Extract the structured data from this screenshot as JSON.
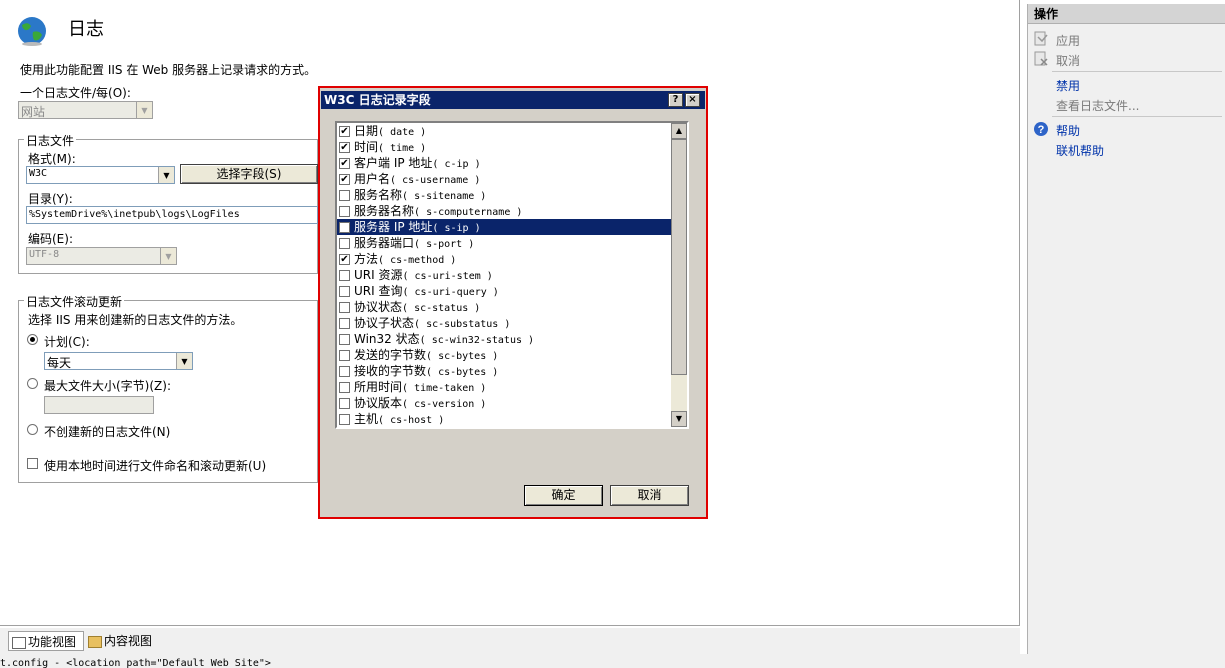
{
  "page": {
    "title": "日志",
    "description": "使用此功能配置 IIS 在 Web 服务器上记录请求的方式。",
    "one_log_label": "一个日志文件/每(O):",
    "one_log_value": "网站",
    "logfile_group": "日志文件",
    "format_label": "格式(M):",
    "format_value": "W3C",
    "select_fields_button": "选择字段(S)",
    "directory_label": "目录(Y):",
    "directory_value": "%SystemDrive%\\inetpub\\logs\\LogFiles",
    "encoding_label": "编码(E):",
    "encoding_value": "UTF-8",
    "rollover_group": "日志文件滚动更新",
    "rollover_desc": "选择 IIS 用来创建新的日志文件的方法。",
    "schedule_label": "计划(C):",
    "schedule_value": "每天",
    "maxsize_label": "最大文件大小(字节)(Z):",
    "no_new_label": "不创建新的日志文件(N)",
    "local_time_label": "使用本地时间进行文件命名和滚动更新(U)"
  },
  "actions": {
    "header": "操作",
    "apply": "应用",
    "cancel": "取消",
    "disable": "禁用",
    "view_logs": "查看日志文件...",
    "help": "帮助",
    "online_help": "联机帮助"
  },
  "dialog": {
    "title": "W3C 日志记录字段",
    "help_btn": "?",
    "close_btn": "×",
    "ok": "确定",
    "cancel": "取消",
    "fields": [
      {
        "name": "日期",
        "code": "date",
        "checked": true
      },
      {
        "name": "时间",
        "code": "time",
        "checked": true
      },
      {
        "name": "客户端 IP 地址",
        "code": "c-ip",
        "checked": true
      },
      {
        "name": "用户名",
        "code": "cs-username",
        "checked": true
      },
      {
        "name": "服务名称",
        "code": "s-sitename",
        "checked": false
      },
      {
        "name": "服务器名称",
        "code": "s-computername",
        "checked": false
      },
      {
        "name": "服务器 IP 地址",
        "code": "s-ip",
        "checked": false,
        "selected": true
      },
      {
        "name": "服务器端口",
        "code": "s-port",
        "checked": false
      },
      {
        "name": "方法",
        "code": "cs-method",
        "checked": true
      },
      {
        "name": "URI 资源",
        "code": "cs-uri-stem",
        "checked": false
      },
      {
        "name": "URI 查询",
        "code": "cs-uri-query",
        "checked": false
      },
      {
        "name": "协议状态",
        "code": "sc-status",
        "checked": false
      },
      {
        "name": "协议子状态",
        "code": "sc-substatus",
        "checked": false
      },
      {
        "name": "Win32 状态",
        "code": "sc-win32-status",
        "checked": false
      },
      {
        "name": "发送的字节数",
        "code": "sc-bytes",
        "checked": false
      },
      {
        "name": "接收的字节数",
        "code": "cs-bytes",
        "checked": false
      },
      {
        "name": "所用时间",
        "code": "time-taken",
        "checked": false
      },
      {
        "name": "协议版本",
        "code": "cs-version",
        "checked": false
      },
      {
        "name": "主机",
        "code": "cs-host",
        "checked": false
      }
    ]
  },
  "tabs": {
    "features_view": "功能视图",
    "content_view": "内容视图"
  },
  "status_text": "t.config - <location path=\"Default Web Site\">"
}
